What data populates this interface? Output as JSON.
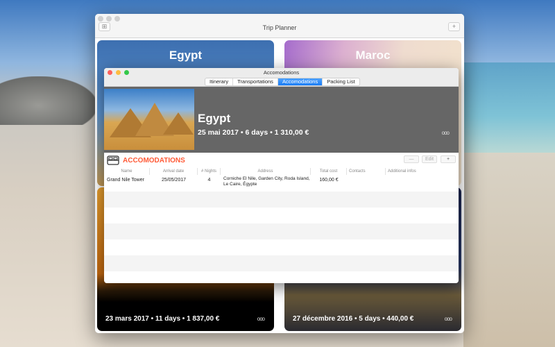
{
  "main_window": {
    "title": "Trip Planner",
    "add_label": "+"
  },
  "cards": [
    {
      "title": "Egypt"
    },
    {
      "title": "Maroc"
    },
    {
      "info": "23 mars 2017 • 11 days • 1 837,00 €",
      "more": "ooo"
    },
    {
      "info": "27 décembre 2016 • 5 days • 440,00 €",
      "more": "ooo"
    }
  ],
  "detail_window": {
    "title": "Accomodations",
    "tabs": [
      "Itinerary",
      "Transportations",
      "Accomodations",
      "Packing List"
    ],
    "selected_tab": "Accomodations",
    "trip": {
      "name": "Egypt",
      "info": "25 mai 2017 • 6 days • 1 310,00 €",
      "more": "ooo"
    },
    "section_title": "ACCOMODATIONS",
    "buttons": {
      "remove": "—",
      "edit": "Edit",
      "add": "+"
    },
    "columns": [
      "Name",
      "Arrival date",
      "# Nights",
      "Address",
      "Total cost",
      "Contacts",
      "Additional infos"
    ],
    "rows": [
      {
        "name": "Grand Nile Tower",
        "arrival": "25/05/2017",
        "nights": "4",
        "address": "Corniche El Nile, Garden City, Roda Island, Le Caire, Égypte",
        "cost": "160,00 €",
        "contacts": "",
        "infos": ""
      }
    ]
  },
  "colors": {
    "accent": "#ff5a36",
    "selected_tab": "#1a7cf5"
  }
}
